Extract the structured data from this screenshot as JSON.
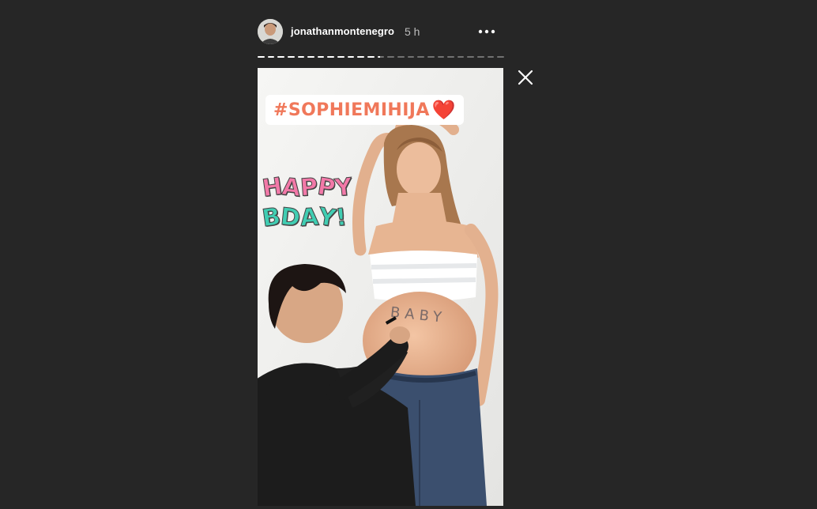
{
  "story": {
    "username": "jonathanmontenegro",
    "timestamp": "5 h",
    "progress": {
      "segments": 25,
      "completed": 12,
      "current_fraction": 0.4
    },
    "hashtag_text": "#SOPHIEMIHIJA",
    "heart_glyph": "❤️",
    "sticker_line1": "HAPPY",
    "sticker_line2": "BDAY!",
    "belly_text": "BABY"
  },
  "icons": {
    "more": "more-options-icon",
    "close": "close-icon"
  },
  "colors": {
    "background": "#262626",
    "hashtag": "#f0785a",
    "sticker_pink": "#f279a8",
    "sticker_teal": "#40cdb2"
  }
}
